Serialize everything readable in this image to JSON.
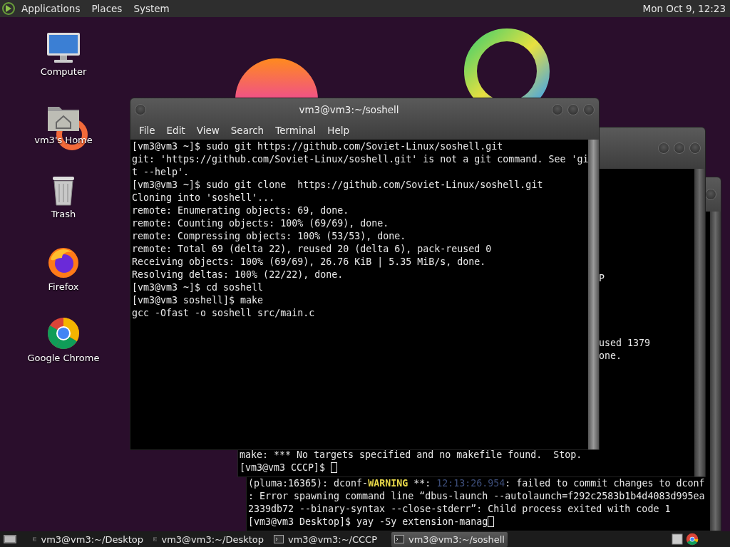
{
  "top_panel": {
    "menus": [
      "Applications",
      "Places",
      "System"
    ],
    "clock": "Mon Oct 9, 12:23"
  },
  "desktop_icons": [
    {
      "kind": "computer",
      "label": "Computer"
    },
    {
      "kind": "home",
      "label": "vm3's Home"
    },
    {
      "kind": "trash",
      "label": "Trash"
    },
    {
      "kind": "firefox",
      "label": "Firefox"
    },
    {
      "kind": "chrome",
      "label": "Google Chrome"
    }
  ],
  "back_terminal": {
    "lines": [
      {
        "segments": [
          {
            "kind": "plain",
            "text": "(pluma:16365): dconf-"
          },
          {
            "kind": "warning",
            "text": "WARNING"
          },
          {
            "kind": "plain",
            "text": " **: "
          },
          {
            "kind": "timestamp",
            "text": "12:13:26.954"
          },
          {
            "kind": "plain",
            "text": ": failed to commit changes to dconf"
          }
        ]
      },
      {
        "text": ": Error spawning command line “dbus-launch --autolaunch=f292c2583b1b4d4083d995ea"
      },
      {
        "text": "2339db72 --binary-syntax --close-stderr”: Child process exited with code 1"
      },
      {
        "text": "[vm3@vm3 Desktop]$ yay -Sy extension-manag",
        "cursor": true
      }
    ]
  },
  "middle_terminal": {
    "fragments": [
      "P",
      "used 1379",
      "one."
    ],
    "lines": [
      {
        "text": "make: *** No targets specified and no makefile found.  Stop."
      },
      {
        "text": "[vm3@vm3 CCCP]$ ",
        "cursor": true
      }
    ]
  },
  "front_terminal": {
    "title": "vm3@vm3:~/soshell",
    "menus": [
      "File",
      "Edit",
      "View",
      "Search",
      "Terminal",
      "Help"
    ],
    "lines": [
      {
        "text": "[vm3@vm3 ~]$ sudo git https://github.com/Soviet-Linux/soshell.git"
      },
      {
        "text": "git: 'https://github.com/Soviet-Linux/soshell.git' is not a git command. See 'gi"
      },
      {
        "text": "t --help'."
      },
      {
        "text": "[vm3@vm3 ~]$ sudo git clone  https://github.com/Soviet-Linux/soshell.git"
      },
      {
        "text": "Cloning into 'soshell'..."
      },
      {
        "text": "remote: Enumerating objects: 69, done."
      },
      {
        "text": "remote: Counting objects: 100% (69/69), done."
      },
      {
        "text": "remote: Compressing objects: 100% (53/53), done."
      },
      {
        "text": "remote: Total 69 (delta 22), reused 20 (delta 6), pack-reused 0"
      },
      {
        "text": "Receiving objects: 100% (69/69), 26.76 KiB | 5.35 MiB/s, done."
      },
      {
        "text": "Resolving deltas: 100% (22/22), done."
      },
      {
        "text": "[vm3@vm3 ~]$ cd soshell"
      },
      {
        "text": "[vm3@vm3 soshell]$ make"
      },
      {
        "text": "gcc -Ofast -o soshell src/main.c"
      }
    ]
  },
  "taskbar": {
    "tasks": [
      {
        "label": "vm3@vm3:~/Desktop",
        "selected": false
      },
      {
        "label": "vm3@vm3:~/Desktop",
        "selected": false
      },
      {
        "label": "vm3@vm3:~/CCCP",
        "selected": false
      },
      {
        "label": "vm3@vm3:~/soshell",
        "selected": true
      }
    ]
  }
}
